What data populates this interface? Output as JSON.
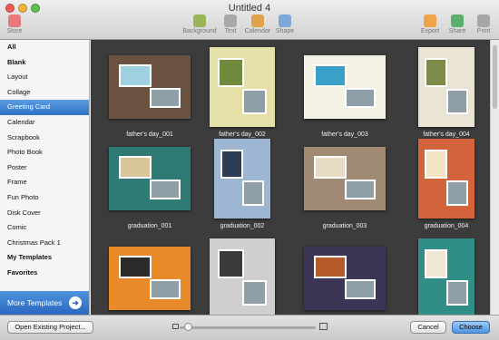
{
  "window": {
    "title": "Untitled 4"
  },
  "toolbar": {
    "items": [
      {
        "label": "Store",
        "icon": "store-icon",
        "color": "#e7787b"
      },
      {
        "label": "Background",
        "icon": "background-icon",
        "color": "#9ab45a"
      },
      {
        "label": "Text",
        "icon": "text-icon",
        "color": "#a9a9a9"
      },
      {
        "label": "Calendar",
        "icon": "calendar-icon",
        "color": "#e0a24a"
      },
      {
        "label": "Shape",
        "icon": "shape-icon",
        "color": "#7ea7d9"
      },
      {
        "label": "Export",
        "icon": "export-icon",
        "color": "#efa44a"
      },
      {
        "label": "Share",
        "icon": "share-icon",
        "color": "#5bb06b"
      },
      {
        "label": "Print",
        "icon": "print-icon",
        "color": "#a7a7a7"
      }
    ]
  },
  "sidebar": {
    "items": [
      {
        "label": "All",
        "bold": true
      },
      {
        "label": "Blank",
        "bold": true
      },
      {
        "label": "Layout"
      },
      {
        "label": "Collage"
      },
      {
        "label": "Greeting Card",
        "selected": true
      },
      {
        "label": "Calendar"
      },
      {
        "label": "Scrapbook"
      },
      {
        "label": "Photo Book"
      },
      {
        "label": "Poster"
      },
      {
        "label": "Frame"
      },
      {
        "label": "Fun Photo"
      },
      {
        "label": "Disk Cover"
      },
      {
        "label": "Comic"
      },
      {
        "label": "Christmas Pack 1"
      },
      {
        "label": "My Templates",
        "bold": true
      },
      {
        "label": "Favorites",
        "bold": true
      }
    ],
    "more_templates_label": "More Templates"
  },
  "templates": [
    {
      "label": "father's day_001",
      "bg": "#6b5140",
      "accent": "#9fd0e0"
    },
    {
      "label": "father's day_002",
      "bg": "#e4e0a8",
      "accent": "#6f8a3c"
    },
    {
      "label": "father's day_003",
      "bg": "#f4f1e6",
      "accent": "#3aa0c8"
    },
    {
      "label": "father's day_004",
      "bg": "#e9e4d4",
      "accent": "#7c8a4a"
    },
    {
      "label": "graduation_001",
      "bg": "#2f7a74",
      "accent": "#d8c69a"
    },
    {
      "label": "graduation_002",
      "bg": "#9db7d3",
      "accent": "#2d3d55"
    },
    {
      "label": "graduation_003",
      "bg": "#a18a73",
      "accent": "#e8dcc4"
    },
    {
      "label": "graduation_004",
      "bg": "#d2633a",
      "accent": "#f3e4c5"
    },
    {
      "label": "",
      "bg": "#e88a2a",
      "accent": "#2b2b2b"
    },
    {
      "label": "",
      "bg": "#cfcfcf",
      "accent": "#3a3a3a"
    },
    {
      "label": "",
      "bg": "#3b3656",
      "accent": "#b65a2a"
    },
    {
      "label": "",
      "bg": "#2f8f86",
      "accent": "#f0e6d4"
    }
  ],
  "footer": {
    "open_existing_label": "Open Existing Project...",
    "cancel_label": "Cancel",
    "choose_label": "Choose"
  },
  "zoom_slider": {
    "value": 0.03
  }
}
